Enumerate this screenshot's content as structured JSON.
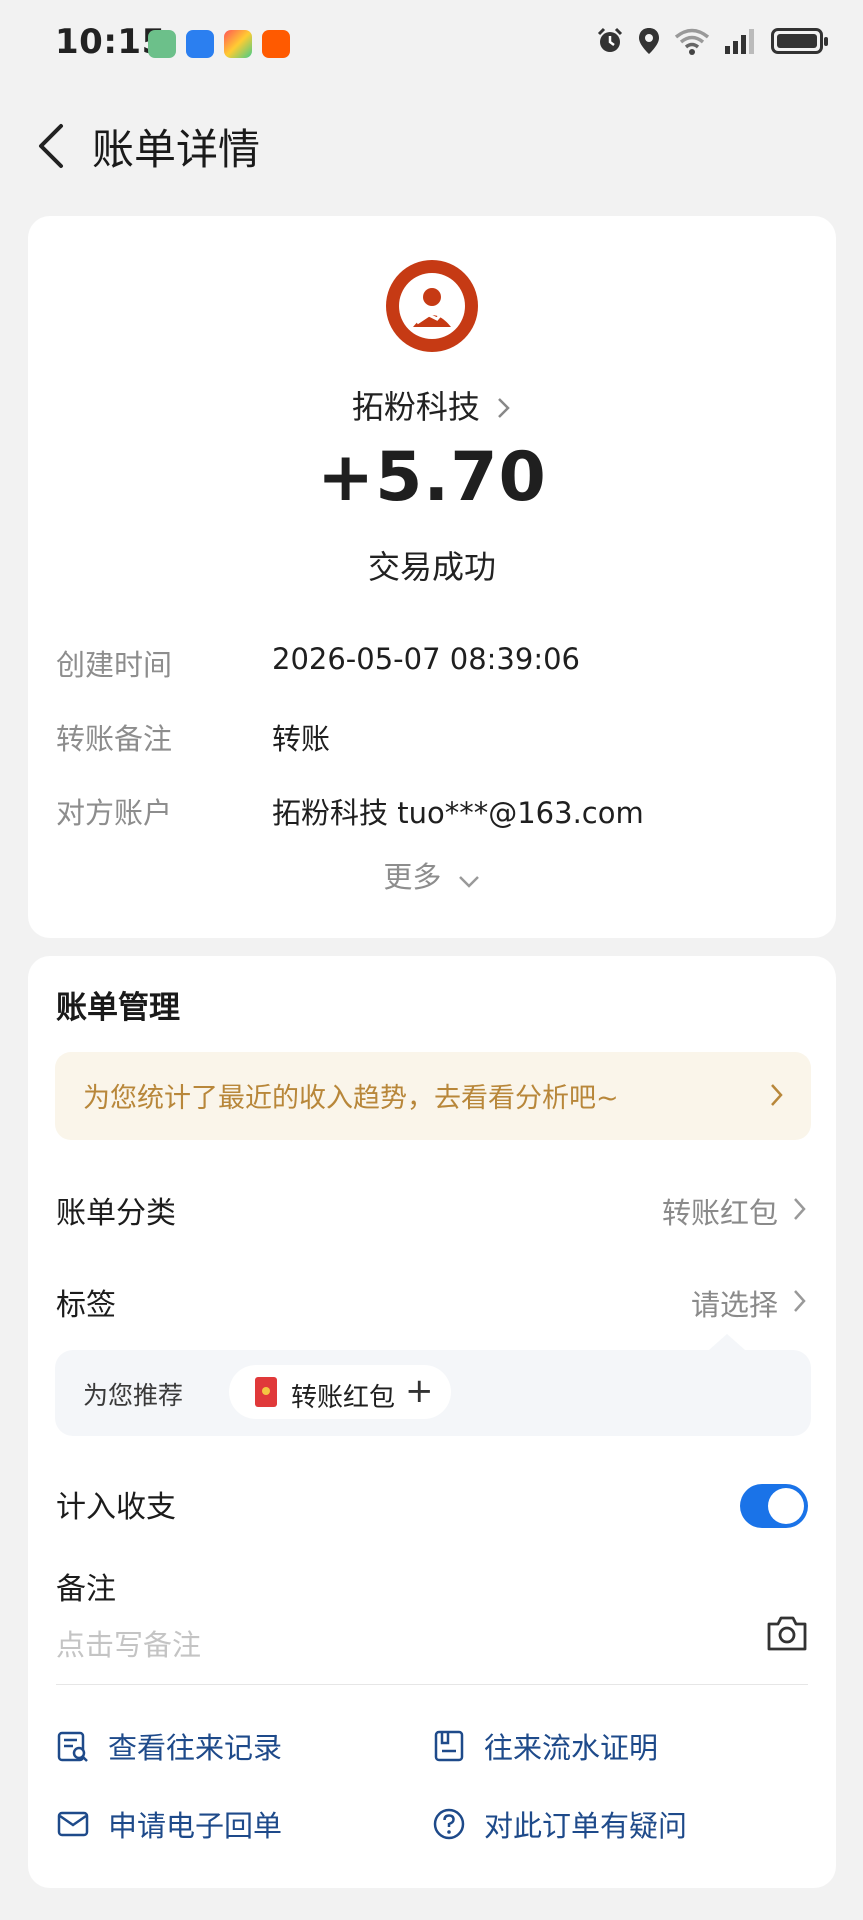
{
  "status_bar": {
    "time": "10:15",
    "app_icons": [
      "maps-icon",
      "messages-icon",
      "store-icon",
      "taobao-icon"
    ],
    "icons": [
      "alarm-icon",
      "location-icon",
      "wifi-icon",
      "signal-icon",
      "battery-icon"
    ]
  },
  "header": {
    "title": "账单详情"
  },
  "transaction": {
    "merchant": "拓粉科技",
    "amount": "+5.70",
    "status": "交易成功",
    "details": [
      {
        "label": "创建时间",
        "value": "2026-05-07 08:39:06"
      },
      {
        "label": "转账备注",
        "value": "转账"
      },
      {
        "label": "对方账户",
        "value": "拓粉科技 tuo***@163.com"
      }
    ],
    "more_label": "更多"
  },
  "management": {
    "title": "账单管理",
    "banner_text": "为您统计了最近的收入趋势，去看看分析吧~",
    "category": {
      "label": "账单分类",
      "value": "转账红包"
    },
    "tag": {
      "label": "标签",
      "value": "请选择"
    },
    "recommend": {
      "label": "为您推荐",
      "chip": "转账红包",
      "chip_action": "+"
    },
    "include": {
      "label": "计入收支",
      "enabled": true
    },
    "memo": {
      "label": "备注",
      "placeholder": "点击写备注"
    },
    "actions": [
      {
        "label": "查看往来记录",
        "icon": "records-icon"
      },
      {
        "label": "往来流水证明",
        "icon": "certificate-icon"
      },
      {
        "label": "申请电子回单",
        "icon": "mail-icon"
      },
      {
        "label": "对此订单有疑问",
        "icon": "help-icon"
      }
    ]
  },
  "colors": {
    "accent": "#1a73e8",
    "link": "#1e4a8a",
    "banner_bg": "#faf5ea",
    "banner_text": "#b8873a",
    "avatar": "#c63a14"
  }
}
